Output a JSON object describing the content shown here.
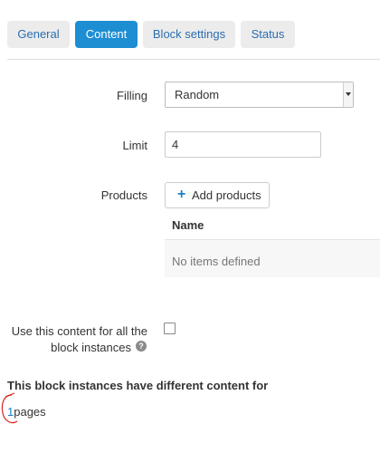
{
  "tabs": [
    {
      "label": "General",
      "active": false
    },
    {
      "label": "Content",
      "active": true
    },
    {
      "label": "Block settings",
      "active": false
    },
    {
      "label": "Status",
      "active": false
    }
  ],
  "form": {
    "filling_label": "Filling",
    "filling_value": "Random",
    "limit_label": "Limit",
    "limit_value": "4",
    "products_label": "Products",
    "add_products_label": "Add products",
    "table_header_name": "Name",
    "table_empty": "No items defined",
    "use_content_label_line1": "Use this content for all the",
    "use_content_label_line2": "block instances",
    "use_content_checked": false
  },
  "notice": {
    "heading": "This block instances have different content for",
    "pages_count": "1",
    "pages_word": "pages"
  },
  "colors": {
    "accent": "#1e8ed3",
    "link": "#1e7fc6",
    "tab_bg": "#ececec",
    "annotation": "#d9231e"
  },
  "icons": {
    "add": "plus-icon",
    "help": "question-circle-icon",
    "dropdown": "caret-down-icon"
  }
}
